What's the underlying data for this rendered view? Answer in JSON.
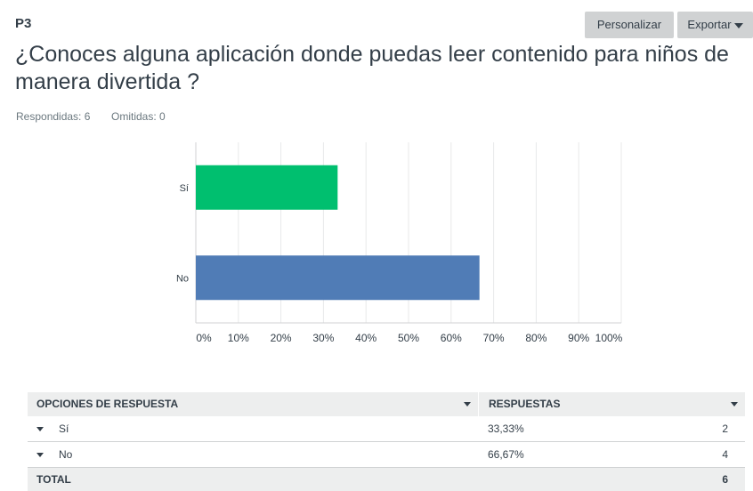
{
  "question": {
    "number": "P3",
    "title": "¿Conoces alguna aplicación donde puedas leer contenido para niños de manera divertida ?",
    "answered_label": "Respondidas: 6",
    "skipped_label": "Omitidas: 0"
  },
  "toolbar": {
    "customize_label": "Personalizar",
    "export_label": "Exportar"
  },
  "chart_data": {
    "type": "bar",
    "orientation": "horizontal",
    "categories": [
      "Sí",
      "No"
    ],
    "values": [
      33.33,
      66.67
    ],
    "colors": [
      "#00bf6f",
      "#507cb6"
    ],
    "xlim": [
      0,
      100
    ],
    "x_ticks": [
      "0%",
      "10%",
      "20%",
      "30%",
      "40%",
      "50%",
      "60%",
      "70%",
      "80%",
      "90%",
      "100%"
    ],
    "grid": true
  },
  "table": {
    "header_option": "OPCIONES DE RESPUESTA",
    "header_responses": "RESPUESTAS",
    "rows": [
      {
        "label": "Sí",
        "percent": "33,33%",
        "count": "2"
      },
      {
        "label": "No",
        "percent": "66,67%",
        "count": "4"
      }
    ],
    "total_label": "TOTAL",
    "total_count": "6"
  }
}
